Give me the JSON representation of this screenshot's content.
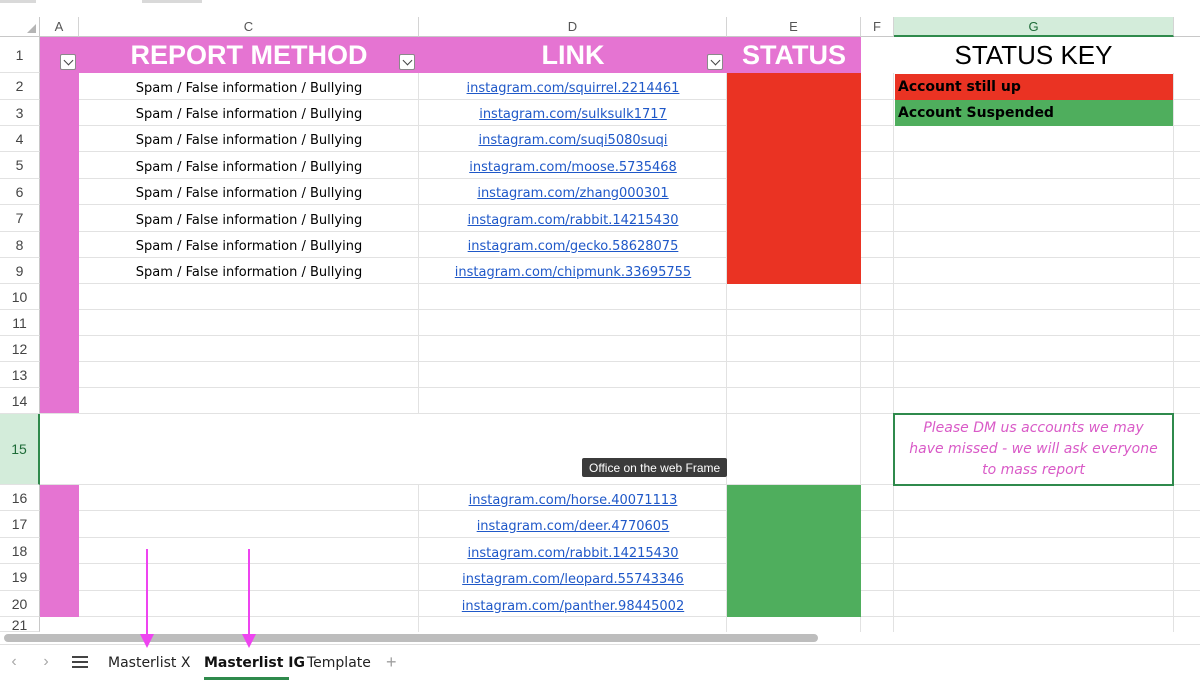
{
  "columns": [
    "A",
    "C",
    "D",
    "E",
    "F",
    "G"
  ],
  "rows": [
    "1",
    "2",
    "3",
    "4",
    "5",
    "6",
    "7",
    "8",
    "9",
    "10",
    "11",
    "12",
    "13",
    "14",
    "15",
    "16",
    "17",
    "18",
    "19",
    "20",
    "21"
  ],
  "headers": {
    "report_method": "REPORT METHOD",
    "link": "LINK",
    "status": "STATUS"
  },
  "report_rows": [
    {
      "method": "Spam / False information / Bullying",
      "link": "instagram.com/squirrel.2214461"
    },
    {
      "method": "Spam / False information / Bullying",
      "link": "instagram.com/sulksulk1717"
    },
    {
      "method": "Spam / False information / Bullying",
      "link": "instagram.com/suqi5080suqi"
    },
    {
      "method": "Spam / False information / Bullying",
      "link": "instagram.com/moose.5735468"
    },
    {
      "method": "Spam / False information / Bullying",
      "link": "instagram.com/zhang000301"
    },
    {
      "method": "Spam / False information / Bullying",
      "link": "instagram.com/rabbit.14215430"
    },
    {
      "method": "Spam / False information / Bullying",
      "link": "instagram.com/gecko.58628075"
    },
    {
      "method": "Spam / False information / Bullying",
      "link": "instagram.com/chipmunk.33695755"
    }
  ],
  "suspended_rows": [
    {
      "link": "instagram.com/horse.40071113"
    },
    {
      "link": "instagram.com/deer.4770605"
    },
    {
      "link": "instagram.com/rabbit.14215430"
    },
    {
      "link": "instagram.com/leopard.55743346"
    },
    {
      "link": "instagram.com/panther.98445002"
    }
  ],
  "status_key": {
    "title": "STATUS KEY",
    "items": [
      {
        "label": "Account still up",
        "color": "#ea3323"
      },
      {
        "label": "Account Suspended",
        "color": "#4fae5d"
      }
    ]
  },
  "note": "Please DM us accounts we may have missed - we will ask everyone to mass report",
  "tooltip": "Office on the web Frame",
  "tabs": [
    {
      "label": "Masterlist X",
      "active": false
    },
    {
      "label": "Masterlist IG",
      "active": true
    },
    {
      "label": "Template",
      "active": false
    }
  ],
  "colors": {
    "header_pink": "#e574d2",
    "status_red": "#ea3323",
    "status_green": "#4fae5d",
    "arrow_magenta": "#ee44f0",
    "selection_green": "#2f8a4c"
  },
  "icons": {
    "filter": "filter-dropdown-icon",
    "prev": "chevron-left-icon",
    "next": "chevron-right-icon",
    "menu": "hamburger-menu-icon",
    "add": "plus-icon"
  }
}
